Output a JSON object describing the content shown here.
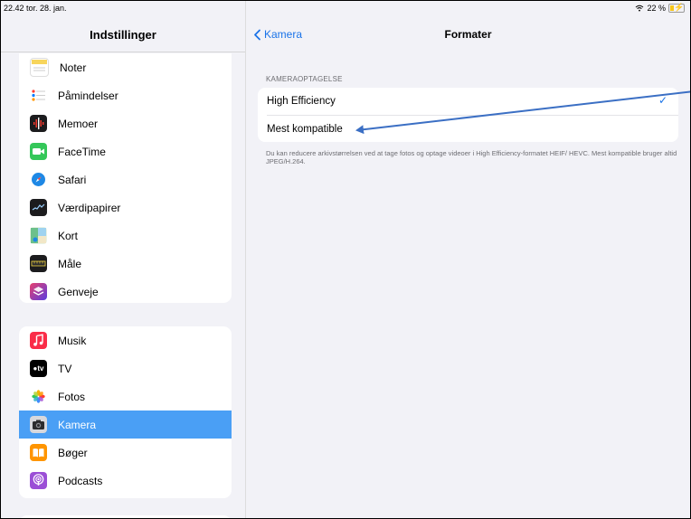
{
  "status_bar": {
    "time": "22.42  tor. 28. jan.",
    "battery": "22 %"
  },
  "sidebar": {
    "title": "Indstillinger",
    "group1": [
      {
        "label": "Noter",
        "icon": "notes-icon",
        "color": "#f7d55c"
      },
      {
        "label": "Påmindelser",
        "icon": "reminders-icon",
        "color": "#ffffff"
      },
      {
        "label": "Memoer",
        "icon": "voice-memos-icon",
        "color": "#1c1c1e"
      },
      {
        "label": "FaceTime",
        "icon": "facetime-icon",
        "color": "#34c759"
      },
      {
        "label": "Safari",
        "icon": "safari-icon",
        "color": "#1e88e5"
      },
      {
        "label": "Værdipapirer",
        "icon": "stocks-icon",
        "color": "#1c1c1e"
      },
      {
        "label": "Kort",
        "icon": "maps-icon",
        "color": "#6cc08b"
      },
      {
        "label": "Måle",
        "icon": "measure-icon",
        "color": "#1c1c1e"
      },
      {
        "label": "Genveje",
        "icon": "shortcuts-icon",
        "color": "#5a3ee0"
      }
    ],
    "group2": [
      {
        "label": "Musik",
        "icon": "music-icon",
        "color": "#fa2d48"
      },
      {
        "label": "TV",
        "icon": "tv-icon",
        "color": "#000000"
      },
      {
        "label": "Fotos",
        "icon": "photos-icon",
        "color": "#ffffff"
      },
      {
        "label": "Kamera",
        "icon": "camera-icon",
        "color": "#5f5f63",
        "selected": true
      },
      {
        "label": "Bøger",
        "icon": "books-icon",
        "color": "#ff9500"
      },
      {
        "label": "Podcasts",
        "icon": "podcasts-icon",
        "color": "#9b4fd6"
      }
    ]
  },
  "detail": {
    "back_label": "Kamera",
    "title": "Formater",
    "section_header": "KAMERAOPTAGELSE",
    "options": [
      {
        "label": "High Efficiency",
        "checked": true
      },
      {
        "label": "Mest kompatible",
        "checked": false
      }
    ],
    "footer": "Du kan reducere arkivstørrelsen ved at tage fotos og optage videoer i High Efficiency-formatet HEIF/ HEVC. Mest kompatible bruger altid JPEG/H.264."
  },
  "colors": {
    "accent": "#1a73e8",
    "selection": "#4a9ff5",
    "annotation_arrow": "#3b6fc4"
  }
}
